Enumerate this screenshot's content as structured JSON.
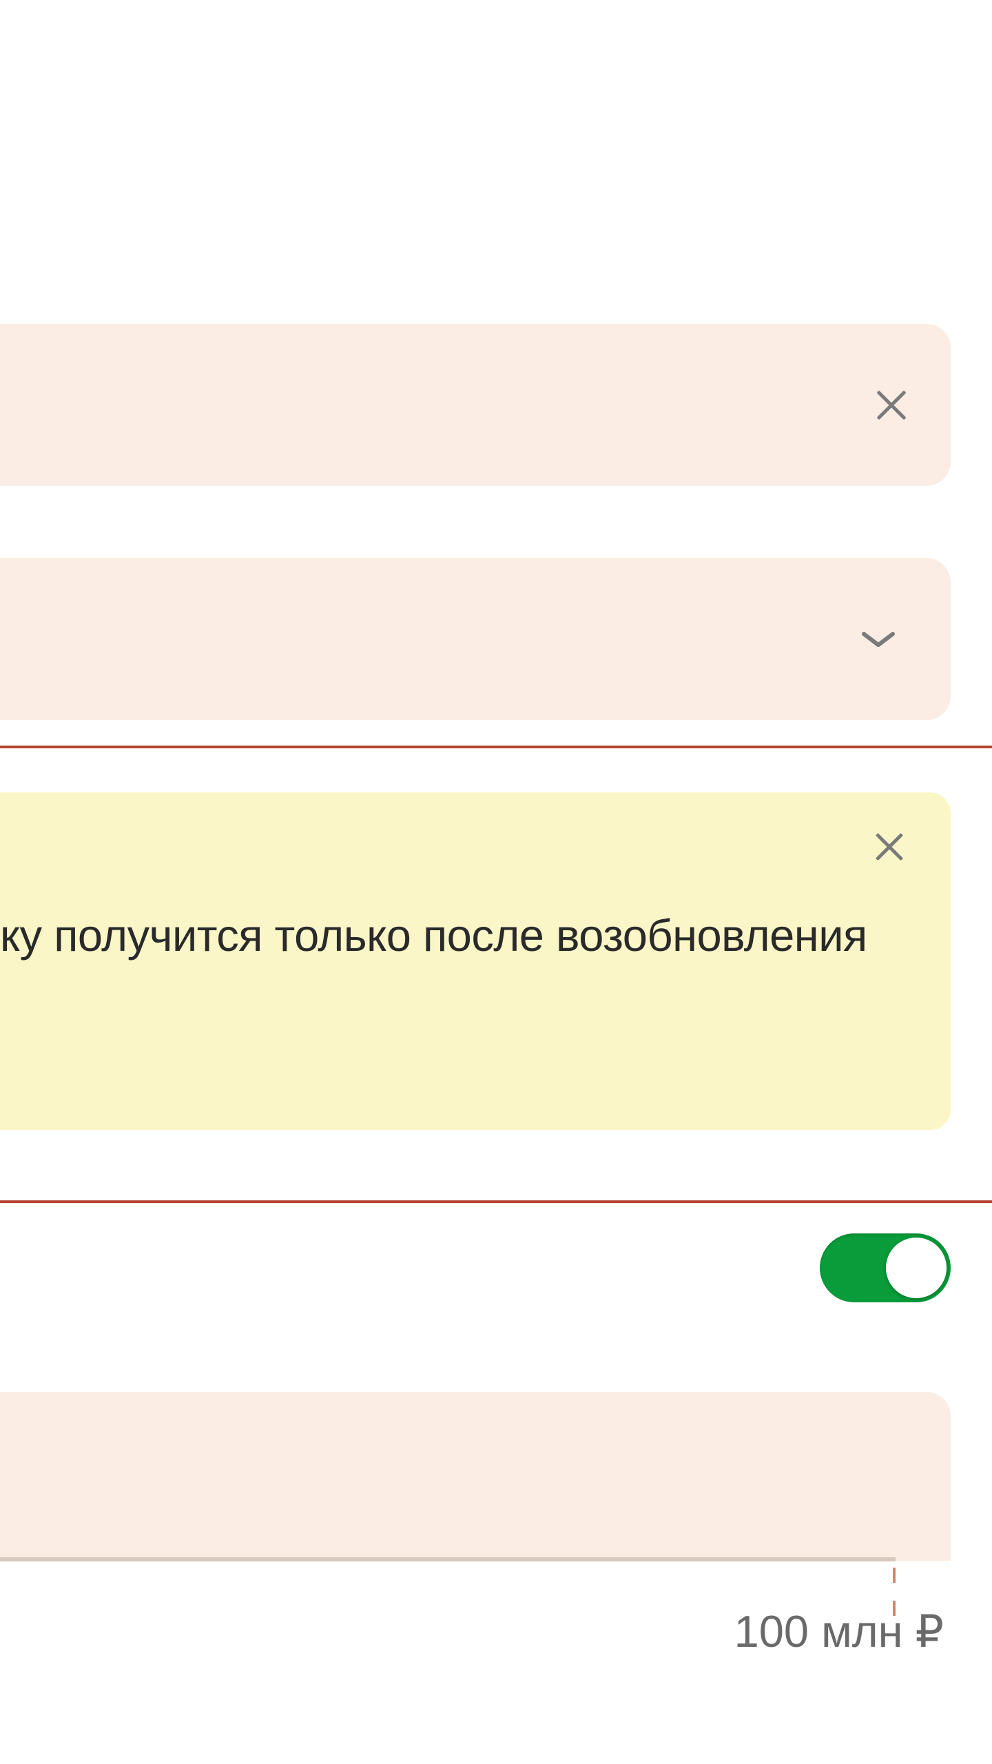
{
  "alert": {
    "message": "ку получится только после возобновления"
  },
  "slider": {
    "max_label": "100 млн ₽"
  },
  "toggle": {
    "state": "on"
  }
}
